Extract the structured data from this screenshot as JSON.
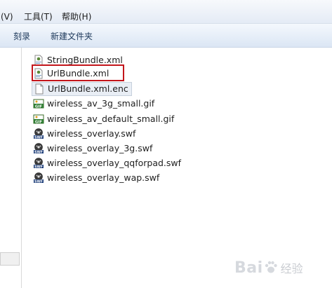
{
  "menubar": {
    "items": [
      {
        "label": "(V)"
      },
      {
        "label": "工具(T)"
      },
      {
        "label": "帮助(H)"
      }
    ]
  },
  "toolbar": {
    "burn_label": "刻录",
    "new_folder_label": "新建文件夹"
  },
  "files": [
    {
      "name": "StringBundle.xml",
      "icon": "xml-file-icon"
    },
    {
      "name": "UrlBundle.xml",
      "icon": "xml-file-icon"
    },
    {
      "name": "UrlBundle.xml.enc",
      "icon": "blank-file-icon"
    },
    {
      "name": "wireless_av_3g_small.gif",
      "icon": "gif-file-icon"
    },
    {
      "name": "wireless_av_default_small.gif",
      "icon": "gif-file-icon"
    },
    {
      "name": "wireless_overlay.swf",
      "icon": "swf-file-icon"
    },
    {
      "name": "wireless_overlay_3g.swf",
      "icon": "swf-file-icon"
    },
    {
      "name": "wireless_overlay_qqforpad.swf",
      "icon": "swf-file-icon"
    },
    {
      "name": "wireless_overlay_wap.swf",
      "icon": "swf-file-icon"
    }
  ],
  "colors": {
    "highlight": "#c3151b",
    "gif_green": "#2e7d32",
    "toolbar_text": "#1e395b"
  },
  "watermark": {
    "text_left": "Bai",
    "text_right": "经验"
  }
}
